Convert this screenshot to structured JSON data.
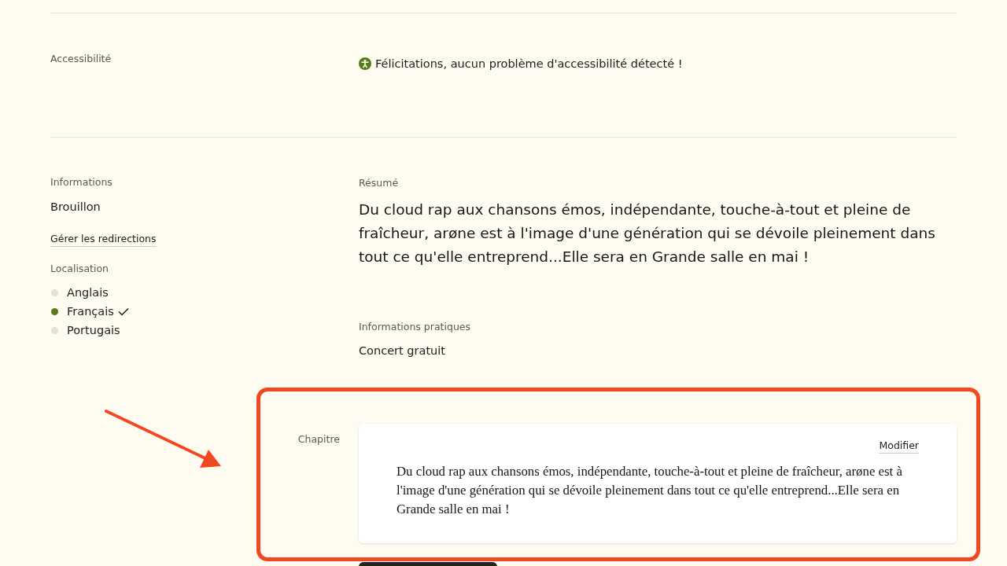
{
  "accessibility": {
    "label": "Accessibilité",
    "message": "Félicitations, aucun problème d'accessibilité détecté !"
  },
  "informations": {
    "label": "Informations",
    "status": "Brouillon",
    "redirects_link": "Gérer les redirections"
  },
  "localisation": {
    "label": "Localisation",
    "languages": [
      {
        "name": "Anglais",
        "selected": false
      },
      {
        "name": "Français",
        "selected": true
      },
      {
        "name": "Portugais",
        "selected": false
      }
    ]
  },
  "resume": {
    "label": "Résumé",
    "text": "Du cloud rap aux chansons émos, indépendante, touche-à-tout et pleine de fraîcheur, arøne est à l'image d'une génération qui se dévoile pleinement dans tout ce qu'elle entreprend...Elle sera en Grande salle en mai !"
  },
  "practical_info": {
    "label": "Informations pratiques",
    "value": "Concert gratuit"
  },
  "chapter": {
    "label": "Chapitre",
    "edit_link": "Modifier",
    "text": "Du cloud rap aux chansons émos, indépendante, touche-à-tout et pleine de fraîcheur, arøne est à l'image d'une génération qui se dévoile pleinement dans tout ce qu'elle entreprend...Elle sera en Grande salle en mai !"
  }
}
